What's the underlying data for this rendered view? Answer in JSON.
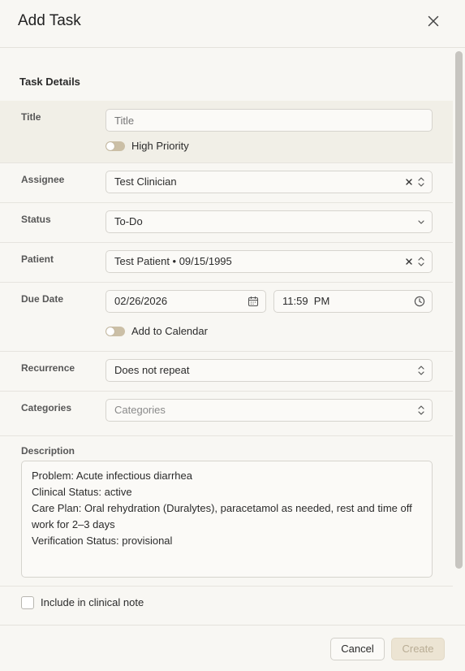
{
  "dialog": {
    "title": "Add Task"
  },
  "section": {
    "title": "Task Details"
  },
  "title_field": {
    "label": "Title",
    "placeholder": "Title",
    "value": ""
  },
  "high_priority": {
    "label": "High Priority",
    "on": false
  },
  "assignee": {
    "label": "Assignee",
    "value": "Test Clinician"
  },
  "status": {
    "label": "Status",
    "value": "To-Do"
  },
  "patient": {
    "label": "Patient",
    "value": "Test Patient • 09/15/1995"
  },
  "due_date": {
    "label": "Due Date",
    "date": "02/26/2026",
    "time": "11:59  PM"
  },
  "add_to_calendar": {
    "label": "Add to Calendar",
    "on": false
  },
  "recurrence": {
    "label": "Recurrence",
    "value": "Does not repeat"
  },
  "categories": {
    "label": "Categories",
    "placeholder": "Categories"
  },
  "description": {
    "label": "Description",
    "value": "Problem: Acute infectious diarrhea\nClinical Status: active\nCare Plan: Oral rehydration (Duralytes), paracetamol as needed, rest and time off work for 2–3 days\nVerification Status: provisional"
  },
  "include_clinical_note": {
    "label": "Include in clinical note",
    "checked": false
  },
  "footer": {
    "cancel_label": "Cancel",
    "create_label": "Create"
  },
  "icons": {
    "close": "close-icon",
    "clear": "clear-icon",
    "updown": "chevron-up-down-icon",
    "chevron_down": "chevron-down-icon",
    "calendar": "calendar-icon",
    "clock": "clock-icon"
  },
  "colors": {
    "background": "#f8f7f3",
    "highlight_row": "#f1efe7",
    "toggle_off": "#cbbfa6",
    "create_disabled_bg": "#ece4d3"
  }
}
